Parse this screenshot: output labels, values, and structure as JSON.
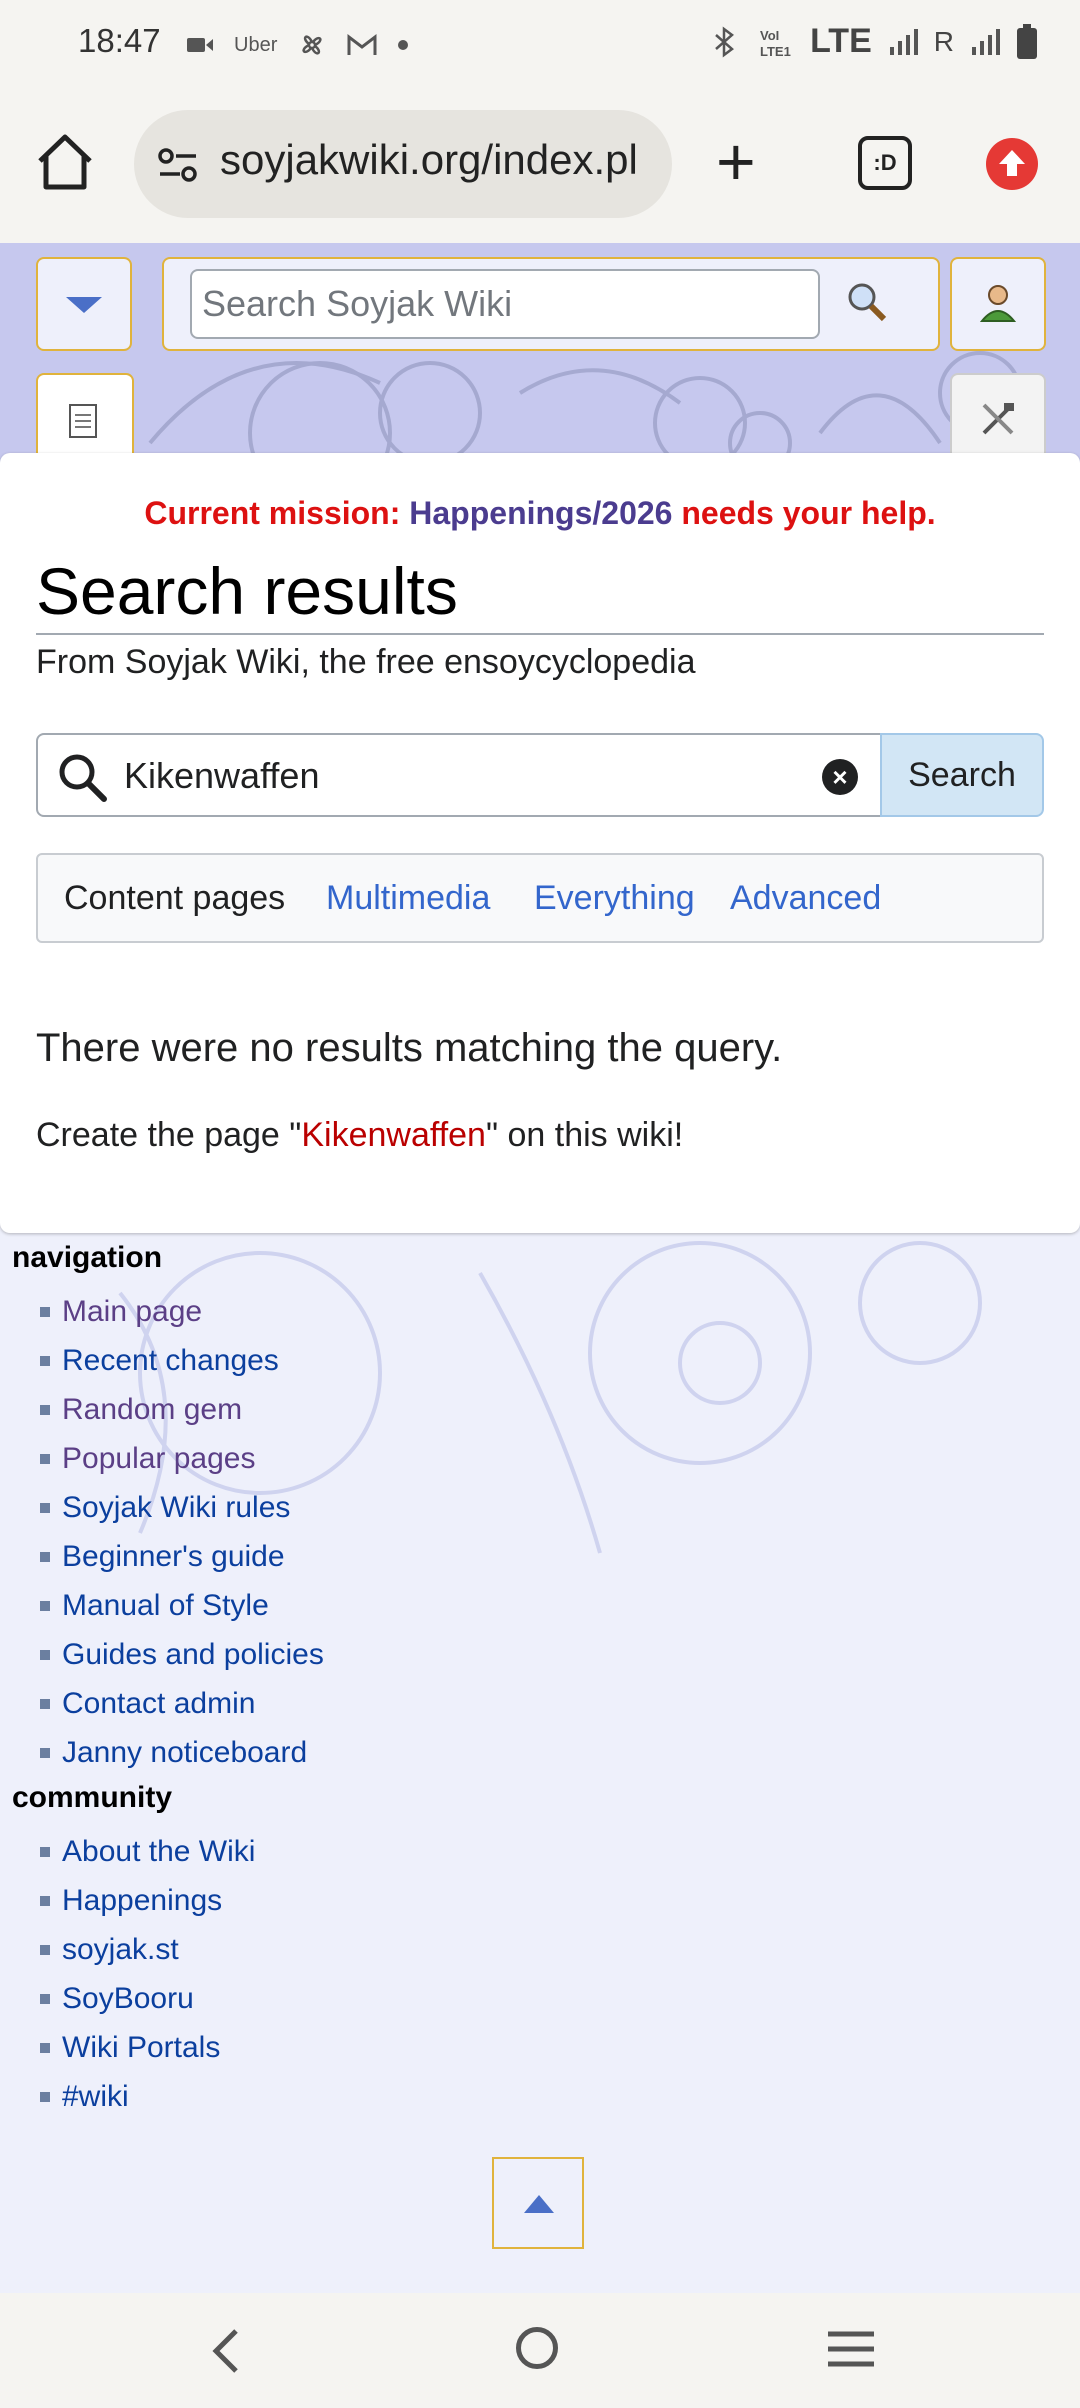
{
  "status_bar": {
    "time": "18:47",
    "left_icons": [
      "video-icon",
      "uber-icon",
      "fan-icon",
      "gmail-icon",
      "dot-icon"
    ],
    "uber_label": "Uber",
    "network": "LTE",
    "roaming": "R"
  },
  "browser": {
    "url": "soyjakwiki.org/index.pl",
    "tabs_label": ":D"
  },
  "wiki_header": {
    "search_placeholder": "Search Soyjak Wiki"
  },
  "content": {
    "mission_prefix": "Current mission: ",
    "mission_link": "Happenings/2026",
    "mission_suffix": " needs your help.",
    "title": "Search results",
    "tagline": "From Soyjak Wiki, the free ensoycyclopedia",
    "search_query": "Kikenwaffen",
    "search_button": "Search",
    "filters": [
      "Content pages",
      "Multimedia",
      "Everything",
      "Advanced"
    ],
    "no_results": "There were no results matching the query.",
    "create_prefix": "Create the page \"",
    "create_link": "Kikenwaffen",
    "create_suffix": "\" on this wiki!"
  },
  "sidebar": {
    "navigation_title": "navigation",
    "navigation": [
      "Main page",
      "Recent changes",
      "Random gem",
      "Popular pages",
      "Soyjak Wiki rules",
      "Beginner's guide",
      "Manual of Style",
      "Guides and policies",
      "Contact admin",
      "Janny noticeboard"
    ],
    "community_title": "community",
    "community": [
      "About the Wiki",
      "Happenings",
      "soyjak.st",
      "SoyBooru",
      "Wiki Portals",
      "#wiki"
    ]
  }
}
